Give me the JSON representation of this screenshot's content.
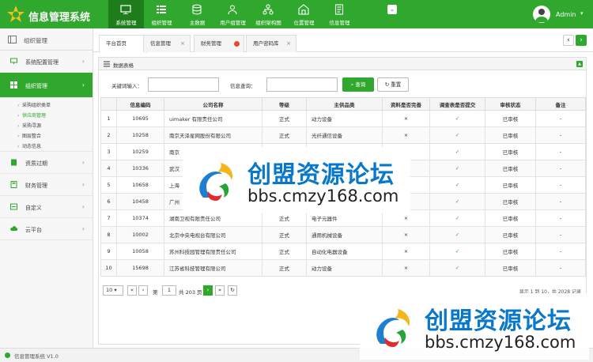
{
  "header": {
    "app_title": "信息管理系统",
    "nav": [
      {
        "label": "系统管理",
        "icon": "monitor-icon",
        "active": true
      },
      {
        "label": "组织管理",
        "icon": "grid-icon"
      },
      {
        "label": "主数据",
        "icon": "database-icon"
      },
      {
        "label": "用户组管理",
        "icon": "user-group-icon"
      },
      {
        "label": "组织架构图",
        "icon": "org-chart-icon"
      },
      {
        "label": "位置管理",
        "icon": "location-icon"
      },
      {
        "label": "信息管理",
        "icon": "document-icon"
      }
    ],
    "user": "Admin"
  },
  "sidebar": {
    "title": "组织管理",
    "items": [
      {
        "label": "系统配置管理"
      },
      {
        "label": "组织管理",
        "active": true
      },
      {
        "label": "资质过期"
      },
      {
        "label": "财务管理"
      },
      {
        "label": "自定义"
      },
      {
        "label": "云平台"
      }
    ],
    "sub_items": [
      "采购组织类单",
      "供应商管理",
      "采购寻源",
      "图层整合",
      "动态信息"
    ]
  },
  "tabs": [
    {
      "label": "平台首页",
      "active": true
    },
    {
      "label": "信息管理",
      "close": "×"
    },
    {
      "label": "财务管理"
    },
    {
      "label": "用户密码库",
      "close": "×"
    }
  ],
  "panel": {
    "title": "数据表格",
    "toggle": "▲"
  },
  "search": {
    "keyword_label": "关键词输入：",
    "info_label": "信息查询：",
    "query_btn": "查询",
    "reset_btn": "重置"
  },
  "table": {
    "headers": [
      "",
      "信息编码",
      "公司名称",
      "等级",
      "主供品类",
      "资料是否完善",
      "调查表是否提交",
      "审核状态",
      "备注"
    ],
    "rows": [
      [
        "1",
        "10695",
        "uimaker 有限责任公司",
        "正式",
        "动力设备",
        "×",
        "✓",
        "已审核",
        "-"
      ],
      [
        "2",
        "10258",
        "南京天泽星网股份有限公司",
        "正式",
        "光纤通信设备",
        "×",
        "✓",
        "已审核",
        "-"
      ],
      [
        "3",
        "10259",
        "南京",
        "",
        "",
        "",
        "✓",
        "已审核",
        "-"
      ],
      [
        "4",
        "10336",
        "武汉",
        "",
        "",
        "",
        "✓",
        "已审核",
        "-"
      ],
      [
        "5",
        "10658",
        "上海",
        "",
        "",
        "",
        "✓",
        "已审核",
        "-"
      ],
      [
        "6",
        "10458",
        "广州",
        "",
        "",
        "",
        "✓",
        "已审核",
        "-"
      ],
      [
        "7",
        "10374",
        "湖南卫视有限责任公司",
        "正式",
        "电子元器件",
        "×",
        "✓",
        "已审核",
        "-"
      ],
      [
        "8",
        "10002",
        "北京中央电视台有限公司",
        "正式",
        "通用机械设备",
        "×",
        "✓",
        "已审核",
        "-"
      ],
      [
        "9",
        "10058",
        "苏州科技园管理有限责任公司",
        "正式",
        "自动化电器设备",
        "×",
        "✓",
        "已审核",
        "-"
      ],
      [
        "10",
        "15698",
        "江苏省科技管理有限公司",
        "正式",
        "动力设备",
        "×",
        "✓",
        "已审核",
        "-"
      ]
    ]
  },
  "pager": {
    "page_size": "10",
    "page_label": "第",
    "page": "1",
    "total_pages": "共 203 页",
    "info": "显示 1 到 10，共 2028 记录"
  },
  "footer": {
    "text": "信息管理系统 V1.0"
  },
  "watermark": {
    "title": "创盟资源论坛",
    "url": "bbs.cmzy168.com"
  }
}
